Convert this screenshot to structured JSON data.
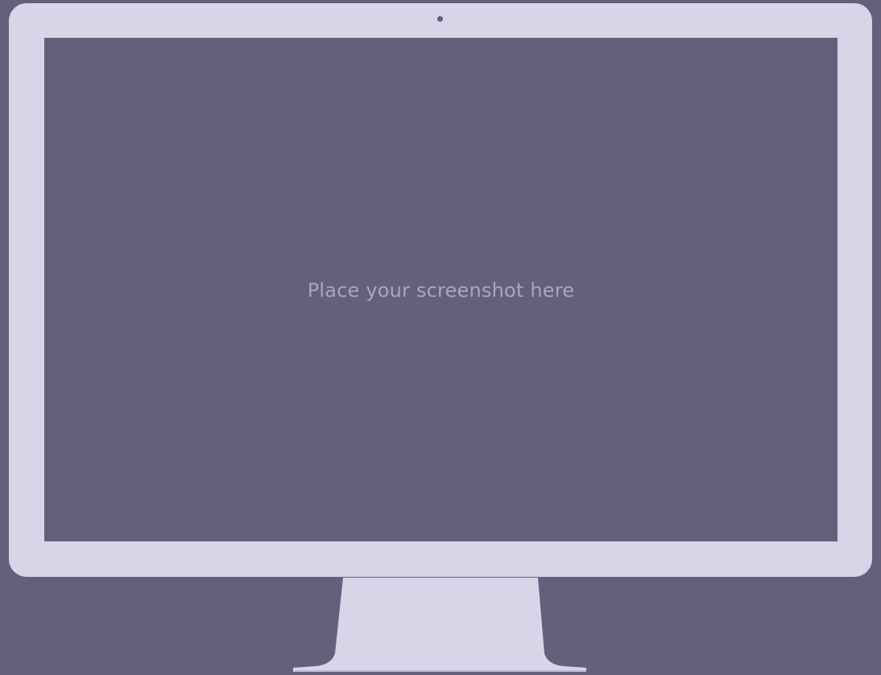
{
  "screen": {
    "placeholder": "Place your screenshot here"
  },
  "colors": {
    "background": "#64607c",
    "bezel": "#d8d5e9",
    "placeholder_text": "#a9a5c0"
  },
  "icons": {
    "camera": "camera-dot-icon"
  }
}
